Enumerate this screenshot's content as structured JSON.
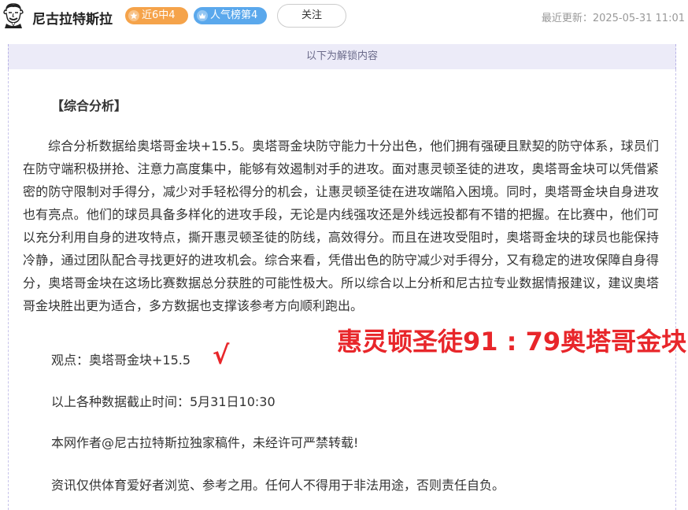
{
  "header": {
    "author_name": "尼古拉特斯拉",
    "badge_streak": "近6中4",
    "badge_rank": "人气榜第4",
    "follow_label": "关注",
    "update_label": "最近更新：",
    "update_time": "2025-05-31 11:01"
  },
  "unlock_notice": "以下为解锁内容",
  "article": {
    "section_title": "【综合分析】",
    "analysis_text": "综合分析数据给奥塔哥金块+15.5。奥塔哥金块防守能力十分出色，他们拥有强硬且默契的防守体系，球员们在防守端积极拼抢、注意力高度集中，能够有效遏制对手的进攻。面对惠灵顿圣徒的进攻，奥塔哥金块可以凭借紧密的防守限制对手得分，减少对手轻松得分的机会，让惠灵顿圣徒在进攻端陷入困境。同时，奥塔哥金块自身进攻也有亮点。他们的球员具备多样化的进攻手段，无论是内线强攻还是外线远投都有不错的把握。在比赛中，他们可以充分利用自身的进攻特点，撕开惠灵顿圣徒的防线，高效得分。而且在进攻受阻时，奥塔哥金块的球员也能保持冷静，通过团队配合寻找更好的进攻机会。综合来看，凭借出色的防守减少对手得分，又有稳定的进攻保障自身得分，奥塔哥金块在这场比赛数据总分获胜的可能性极大。所以综合以上分析和尼古拉专业数据情报建议，建议奥塔哥金块胜出更为适合，多方数据也支撑该参考方向顺利跑出。",
    "viewpoint": "观点：奥塔哥金块+15.5",
    "check_mark": "√",
    "result_score": "惠灵顿圣徒91 : 79奥塔哥金块",
    "cutoff_time": "以上各种数据截止时间：5月31日10:30",
    "copyright": "本网作者@尼古拉特斯拉独家稿件，未经许可严禁转载!",
    "disclaimer": "资讯仅供体育爱好者浏览、参考之用。任何人不得用于非法用途，否则责任自负。"
  },
  "icons": {
    "avatar": "cartoon-portrait-avatar",
    "streak_badge_icon": "star-icon",
    "rank_badge_icon": "crown-icon"
  },
  "colors": {
    "streak_badge": "#f5a34a",
    "rank_badge": "#5aa8ec",
    "result_highlight": "#e8262a",
    "unlock_bar_bg": "#ecebf8"
  }
}
